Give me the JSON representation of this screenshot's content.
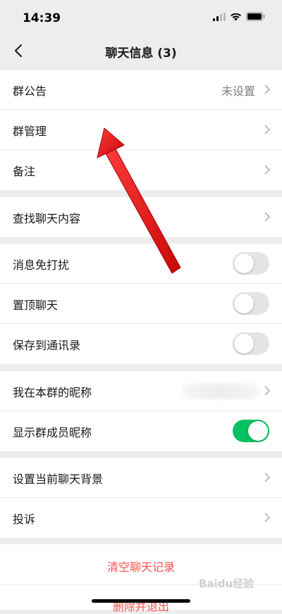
{
  "status": {
    "time": "14:39"
  },
  "nav": {
    "title": "聊天信息 (3)"
  },
  "group1": [
    {
      "label": "群公告",
      "value": "未设置"
    },
    {
      "label": "群管理"
    },
    {
      "label": "备注"
    }
  ],
  "group2": [
    {
      "label": "查找聊天内容"
    }
  ],
  "group3": [
    {
      "label": "消息免打扰",
      "on": false
    },
    {
      "label": "置顶聊天",
      "on": false
    },
    {
      "label": "保存到通讯录",
      "on": false
    }
  ],
  "group4": [
    {
      "label": "我在本群的昵称"
    },
    {
      "label": "显示群成员昵称",
      "on": true
    }
  ],
  "group5": [
    {
      "label": "设置当前聊天背景"
    },
    {
      "label": "投诉"
    }
  ],
  "actions": {
    "clear": "清空聊天记录",
    "delete": "删除并退出"
  },
  "watermark": "Baidu经验",
  "colors": {
    "accent": "#07c160",
    "danger": "#fa5151",
    "annotation": "#e01010"
  }
}
